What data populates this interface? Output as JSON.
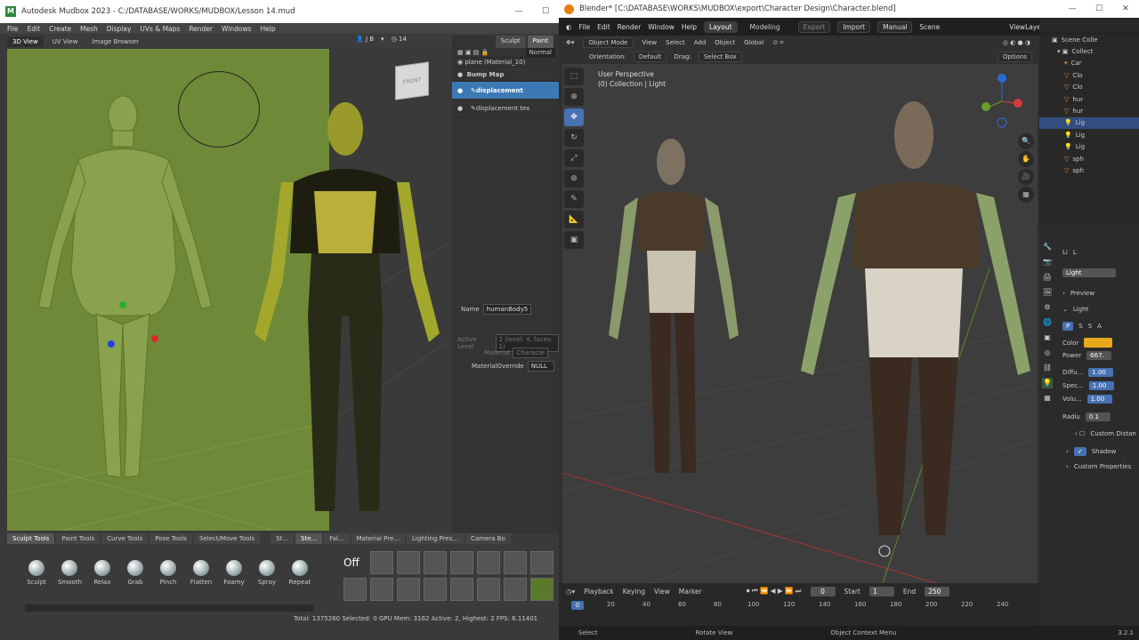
{
  "mudbox": {
    "title": "Autodesk Mudbox 2023 - C:/DATABASE/WORKS/MUDBOX/Lesson 14.mud",
    "menu": [
      "File",
      "Edit",
      "Create",
      "Mesh",
      "Display",
      "UVs & Maps",
      "Render",
      "Windows",
      "Help"
    ],
    "view_tabs": [
      "3D View",
      "UV View",
      "Image Browser"
    ],
    "toolbar_right": {
      "user": "J B",
      "count": "14"
    },
    "cube_label": "FRONT",
    "side_tabs": [
      "Sculpt",
      "Paint"
    ],
    "layers": {
      "blend_mode": "Normal",
      "material_row": "plane (Material_10)",
      "group": "Bump Map",
      "items": [
        "displacement",
        "displacement tex"
      ]
    },
    "properties": {
      "name_label": "Name",
      "name_value": "humanBody5",
      "active_level_label": "Active Level",
      "active_level_value": "2 (level: 4, faces: 1)",
      "material_label": "Material",
      "material_value": "Characte",
      "override_label": "MaterialOverride",
      "override_value": "NULL"
    },
    "tray_tabs": [
      "Sculpt Tools",
      "Paint Tools",
      "Curve Tools",
      "Pose Tools",
      "Select/Move Tools",
      "St...",
      "Ste...",
      "Fal...",
      "Material Pre...",
      "Lighting Pres...",
      "Camera Bo"
    ],
    "tools": [
      "Sculpt",
      "Smooth",
      "Relax",
      "Grab",
      "Pinch",
      "Flatten",
      "Foamy",
      "Spray",
      "Repeat"
    ],
    "stamp_off": "Off",
    "status": "Total: 1375260  Selected: 0  GPU Mem: 3162  Active: 2, Highest: 2  FPS: 6.11401"
  },
  "blender": {
    "title": "Blender* [C:\\DATABASE\\WORKS\\MUDBOX\\export\\Character Design\\Character.blend]",
    "menu": [
      "File",
      "Edit",
      "Render",
      "Window",
      "Help"
    ],
    "workspaces": [
      "Layout",
      "Modeling"
    ],
    "header_right": {
      "export": "Export",
      "import": "Import",
      "manual": "Manual",
      "scene": "Scene",
      "viewlayer": "ViewLayer"
    },
    "header": {
      "mode": "Object Mode",
      "items": [
        "View",
        "Select",
        "Add",
        "Object"
      ],
      "transform": "Global"
    },
    "header2": {
      "orientation_label": "Orientation:",
      "orientation": "Default",
      "drag_label": "Drag:",
      "drag": "Select Box",
      "options": "Options"
    },
    "viewport_info": [
      "User Perspective",
      "(0) Collection | Light"
    ],
    "outliner": {
      "root": "Scene Colle",
      "collection": "Collect",
      "items": [
        "Car",
        "Clo",
        "Clo",
        "hur",
        "hur",
        "Lig",
        "Lig",
        "Lig",
        "sph",
        "sph"
      ]
    },
    "props": {
      "object_short": "Li",
      "data_short": "L",
      "light_name": "Light",
      "sections": {
        "preview": "Preview",
        "light": "Light",
        "custom_distance": "Custom Distan",
        "shadow": "Shadow",
        "custom_props": "Custom Properties"
      },
      "color_label": "Color",
      "power_label": "Power",
      "power_value": "667.",
      "diffuse_label": "Diffu...",
      "diffuse_value": "1.00",
      "specular_label": "Spec...",
      "specular_value": "1.00",
      "volume_label": "Volu...",
      "volume_value": "1.00",
      "radius_label": "Radiu",
      "radius_value": "0.1",
      "light_types": [
        "P",
        "S",
        "S",
        "A"
      ]
    },
    "timeline": {
      "items": [
        "Playback",
        "Keying",
        "View",
        "Marker"
      ],
      "current": "0",
      "start_label": "Start",
      "start": "1",
      "end_label": "End",
      "end": "250",
      "ticks": [
        "0",
        "20",
        "40",
        "60",
        "80",
        "100",
        "120",
        "140",
        "160",
        "180",
        "200",
        "220",
        "240"
      ]
    },
    "status": [
      "Select",
      "Rotate View",
      "Object Context Menu"
    ],
    "version": "3.2.1"
  },
  "colors": {
    "mud_viewport": "#6e8a38",
    "accent_blue": "#4772b3",
    "light_color": "#e8a91b"
  }
}
